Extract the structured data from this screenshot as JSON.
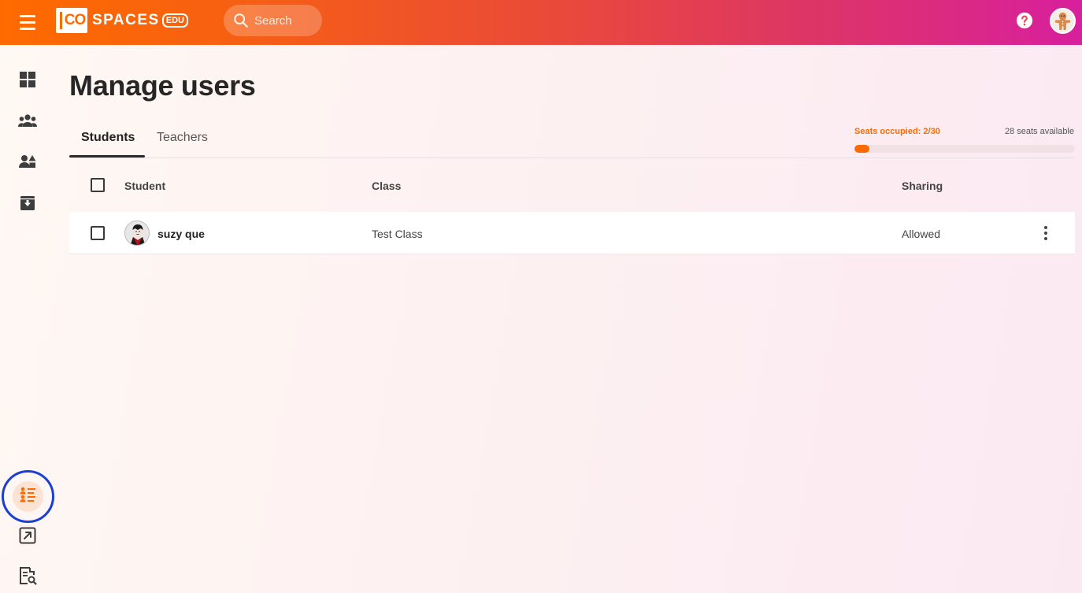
{
  "header": {
    "logo_mark": "CO",
    "logo_text": "SPACES",
    "logo_edu": "EDU",
    "search_placeholder": "Search"
  },
  "sidebar": {
    "items": [
      {
        "name": "dashboard",
        "icon": "grid-icon"
      },
      {
        "name": "classes",
        "icon": "people-group-icon"
      },
      {
        "name": "users",
        "icon": "person-shapes-icon"
      },
      {
        "name": "archive",
        "icon": "archive-box-icon"
      },
      {
        "name": "manage-users",
        "icon": "user-list-icon",
        "active": true
      },
      {
        "name": "share",
        "icon": "external-link-icon"
      },
      {
        "name": "review",
        "icon": "document-search-icon"
      }
    ]
  },
  "main": {
    "title": "Manage users",
    "tabs": [
      {
        "label": "Students",
        "active": true
      },
      {
        "label": "Teachers",
        "active": false
      }
    ],
    "seats": {
      "occupied_label": "Seats occupied: 2/30",
      "available_label": "28 seats available",
      "occupied": 2,
      "total": 30
    },
    "table": {
      "headers": {
        "student": "Student",
        "class": "Class",
        "sharing": "Sharing"
      },
      "rows": [
        {
          "name": "suzy que",
          "class": "Test Class",
          "sharing": "Allowed"
        }
      ]
    }
  },
  "colors": {
    "accent": "#ff6a00",
    "header_gradient_start": "#ff6a00",
    "header_gradient_end": "#d81f9e",
    "focus_ring": "#1a3fd4"
  }
}
